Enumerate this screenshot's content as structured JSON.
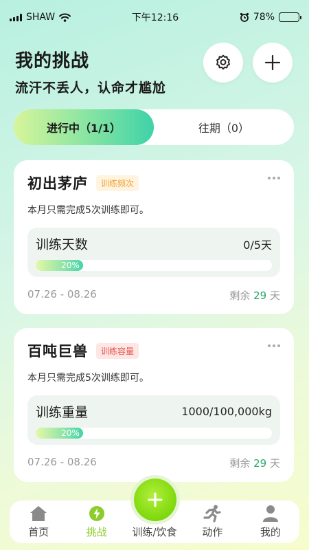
{
  "status_bar": {
    "carrier": "SHAW",
    "time": "下午12:16",
    "battery_percent": "78%",
    "battery_level": 0.78
  },
  "header": {
    "title": "我的挑战",
    "subtitle": "流汗不丢人，认命才尴尬"
  },
  "tabs": [
    {
      "label": "进行中（1/1）",
      "active": true
    },
    {
      "label": "往期（0）",
      "active": false
    }
  ],
  "challenges": [
    {
      "title": "初出茅庐",
      "tag": "训练频次",
      "tag_color": "#f2a23a",
      "description": "本月只需完成5次训练即可。",
      "metric_label": "训练天数",
      "metric_value": "0/5天",
      "progress_label": "20%",
      "progress": 0.2,
      "date_range": "07.26 - 08.26",
      "remain_prefix": "剩余",
      "remain_days": "29",
      "remain_suffix": "天"
    },
    {
      "title": "百吨巨兽",
      "tag": "训练容量",
      "tag_color": "#e8544a",
      "description": "本月只需完成5次训练即可。",
      "metric_label": "训练重量",
      "metric_value": "1000/100,000kg",
      "progress_label": "20%",
      "progress": 0.2,
      "date_range": "07.26 - 08.26",
      "remain_prefix": "剩余",
      "remain_days": "29",
      "remain_suffix": "天"
    }
  ],
  "tabbar": [
    {
      "label": "首页",
      "icon": "home-icon"
    },
    {
      "label": "挑战",
      "icon": "lightning-icon",
      "active": true
    },
    {
      "label": "训练/饮食",
      "icon": "plus-icon"
    },
    {
      "label": "动作",
      "icon": "running-icon"
    },
    {
      "label": "我的",
      "icon": "profile-icon"
    }
  ],
  "colors": {
    "accent_green": "#7ed80c",
    "remain_green": "#2ea86b",
    "active_tab_label": "#8ccd2c"
  }
}
